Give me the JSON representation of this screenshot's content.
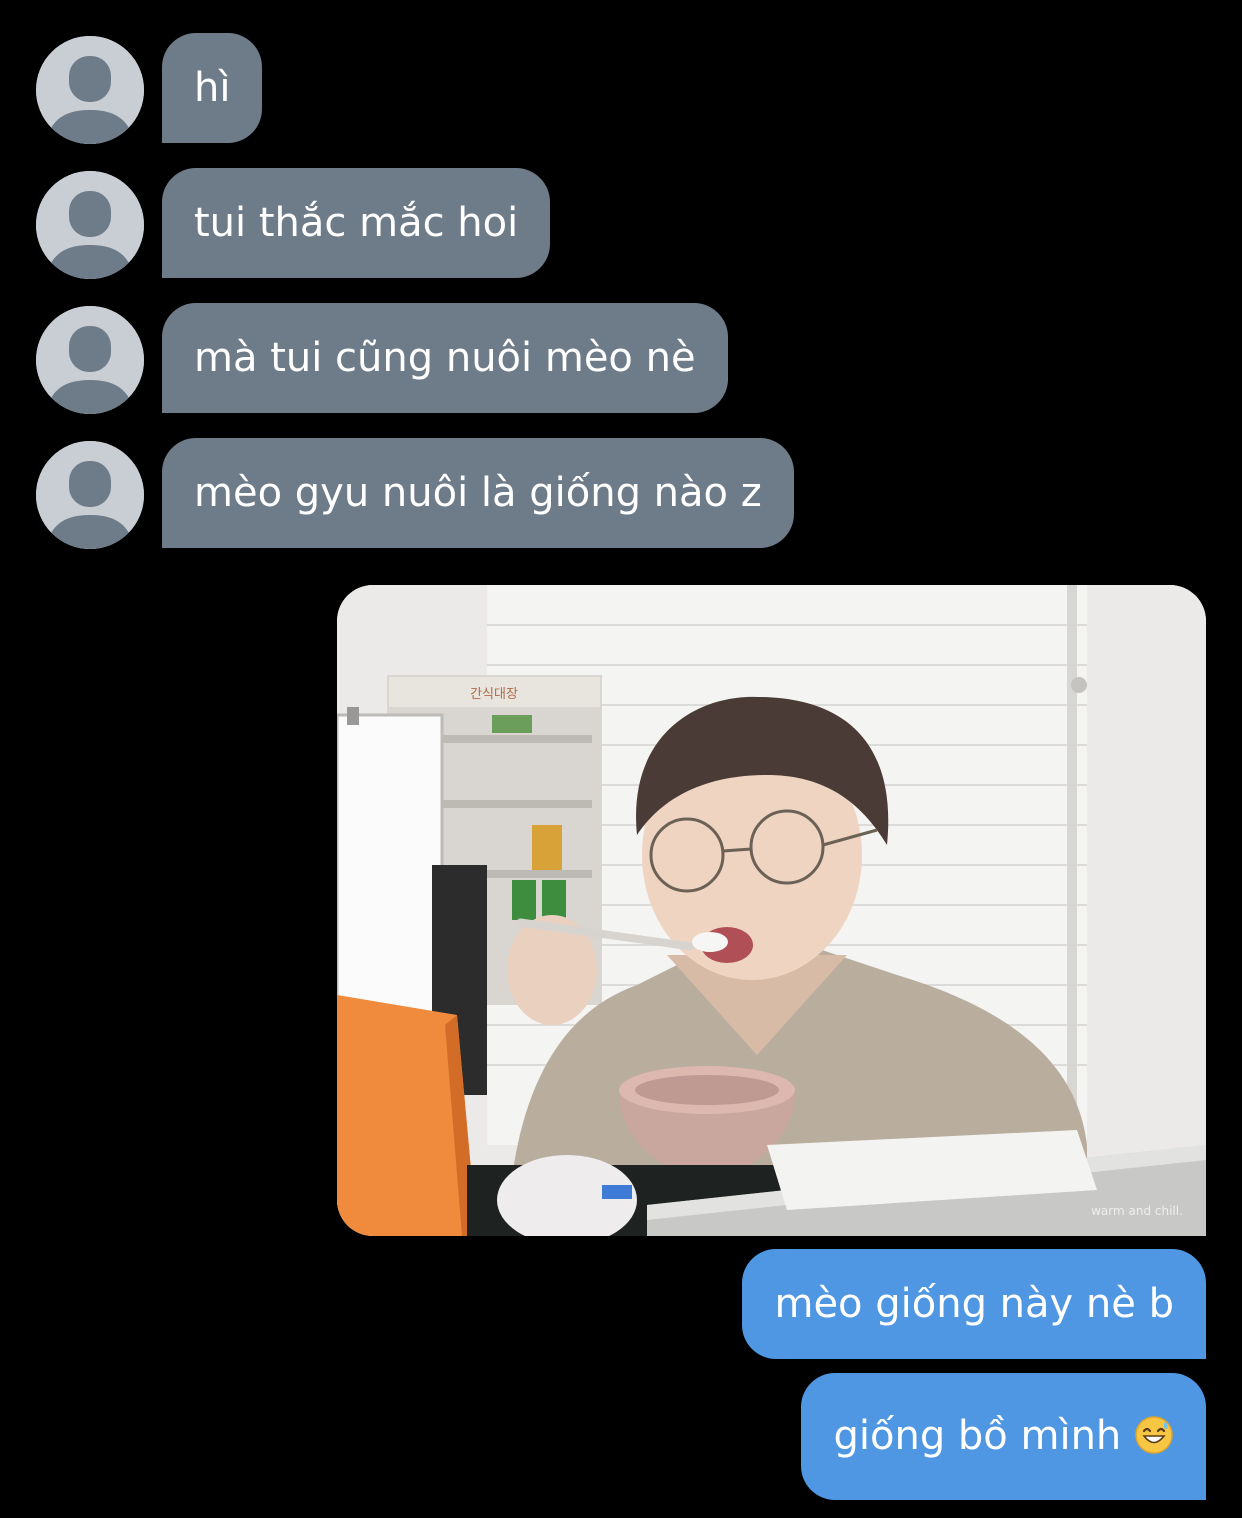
{
  "conversation": {
    "incoming": [
      {
        "text": "hì"
      },
      {
        "text": "tui thắc mắc hoi"
      },
      {
        "text": "mà tui cũng nuôi mèo nè"
      },
      {
        "text": "mèo gyu nuôi là giống nào z"
      }
    ],
    "outgoing": {
      "photo": {
        "signage_text": "간식대장",
        "watermark": "warm and chill."
      },
      "messages": [
        {
          "text": "mèo giống này nè b"
        },
        {
          "text": "giống bồ mình",
          "emoji": "grinning-sweat-emoji"
        }
      ]
    }
  },
  "colors": {
    "background": "#000000",
    "incoming_bubble": "#6e7b89",
    "outgoing_bubble": "#4f97e3",
    "avatar_bg": "#c9ced4",
    "avatar_fg": "#6e7b89",
    "text": "#ffffff"
  }
}
